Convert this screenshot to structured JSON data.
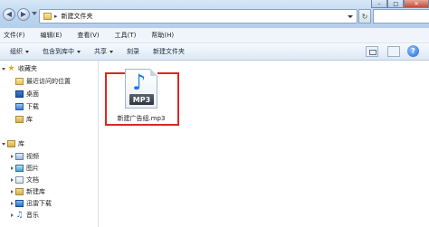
{
  "window": {
    "controls": {
      "minimize": "–",
      "maximize": "□",
      "close": "✕"
    }
  },
  "address_bar": {
    "separator": "▸",
    "path": "新建文件夹",
    "icon": "folder-icon"
  },
  "navigation": {
    "back_icon": "◀",
    "forward_icon": "▶",
    "refresh_icon": "↻"
  },
  "menu": [
    "文件(F)",
    "编辑(E)",
    "查看(V)",
    "工具(T)",
    "帮助(H)"
  ],
  "toolbar": {
    "organize": "组织",
    "include_in_library": "包含到库中",
    "share": "共享",
    "burn": "刻录",
    "new_folder": "新建文件夹",
    "help": "?"
  },
  "sidebar": {
    "favorites": {
      "label": "收藏夹",
      "items": [
        {
          "label": "最近访问的位置",
          "icon": "recent-places-icon"
        },
        {
          "label": "桌面",
          "icon": "desktop-icon"
        },
        {
          "label": "下载",
          "icon": "download-icon"
        },
        {
          "label": "库",
          "icon": "library-icon"
        }
      ]
    },
    "libraries": {
      "label": "库",
      "items": [
        {
          "label": "视频",
          "icon": "video-icon"
        },
        {
          "label": "图片",
          "icon": "pictures-icon"
        },
        {
          "label": "文档",
          "icon": "documents-icon"
        },
        {
          "label": "新建库",
          "icon": "library-icon"
        },
        {
          "label": "迅雷下载",
          "icon": "thunder-download-icon"
        },
        {
          "label": "音乐",
          "icon": "music-icon"
        }
      ]
    }
  },
  "content": {
    "files": [
      {
        "name": "新建广告组.mp3",
        "badge": "MP3",
        "icon": "mp3-file-icon"
      }
    ]
  },
  "colors": {
    "highlight_border": "#e0251f",
    "toolbar_bg": "#dce8f5",
    "title_bg": "#bcd5ee"
  }
}
